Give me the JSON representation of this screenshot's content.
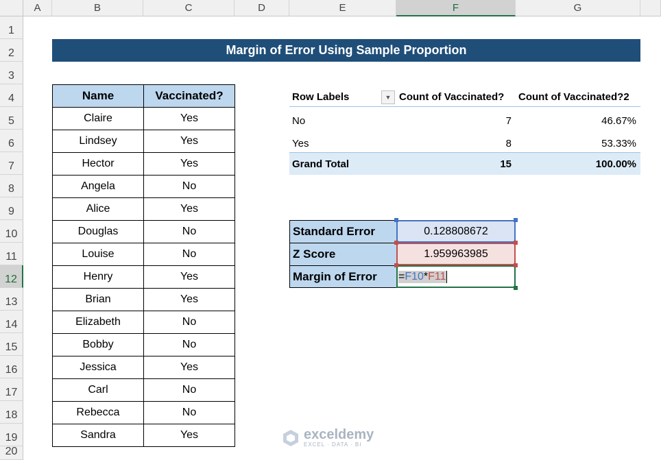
{
  "columns": [
    "A",
    "B",
    "C",
    "D",
    "E",
    "F",
    "G"
  ],
  "rows": [
    "1",
    "2",
    "3",
    "4",
    "5",
    "6",
    "7",
    "8",
    "9",
    "10",
    "11",
    "12",
    "13",
    "14",
    "15",
    "16",
    "17",
    "18",
    "19",
    "20"
  ],
  "title": "Margin of Error Using Sample Proportion",
  "data_table": {
    "headers": [
      "Name",
      "Vaccinated?"
    ],
    "rows": [
      [
        "Claire",
        "Yes"
      ],
      [
        "Lindsey",
        "Yes"
      ],
      [
        "Hector",
        "Yes"
      ],
      [
        "Angela",
        "No"
      ],
      [
        "Alice",
        "Yes"
      ],
      [
        "Douglas",
        "No"
      ],
      [
        "Louise",
        "No"
      ],
      [
        "Henry",
        "Yes"
      ],
      [
        "Brian",
        "Yes"
      ],
      [
        "Elizabeth",
        "No"
      ],
      [
        "Bobby",
        "No"
      ],
      [
        "Jessica",
        "Yes"
      ],
      [
        "Carl",
        "No"
      ],
      [
        "Rebecca",
        "No"
      ],
      [
        "Sandra",
        "Yes"
      ]
    ]
  },
  "pivot": {
    "headers": [
      "Row Labels",
      "Count of Vaccinated?",
      "Count of Vaccinated?2"
    ],
    "rows": [
      [
        "No",
        "7",
        "46.67%"
      ],
      [
        "Yes",
        "8",
        "53.33%"
      ]
    ],
    "total": [
      "Grand Total",
      "15",
      "100.00%"
    ]
  },
  "calc": {
    "standard_error_label": "Standard Error",
    "standard_error_value": "0.128808672",
    "z_score_label": "Z Score",
    "z_score_value": "1.959963985",
    "margin_label": "Margin of Error",
    "formula_eq": "=",
    "formula_ref1": "F10",
    "formula_op": "*",
    "formula_ref2": "F11"
  },
  "watermark": {
    "name": "exceldemy",
    "tagline": "EXCEL · DATA · BI"
  },
  "colors": {
    "title_bg": "#1f4e79",
    "header_bg": "#bdd7ee",
    "ref1_color": "#4472c4",
    "ref2_color": "#c0504d",
    "select_green": "#217346"
  }
}
